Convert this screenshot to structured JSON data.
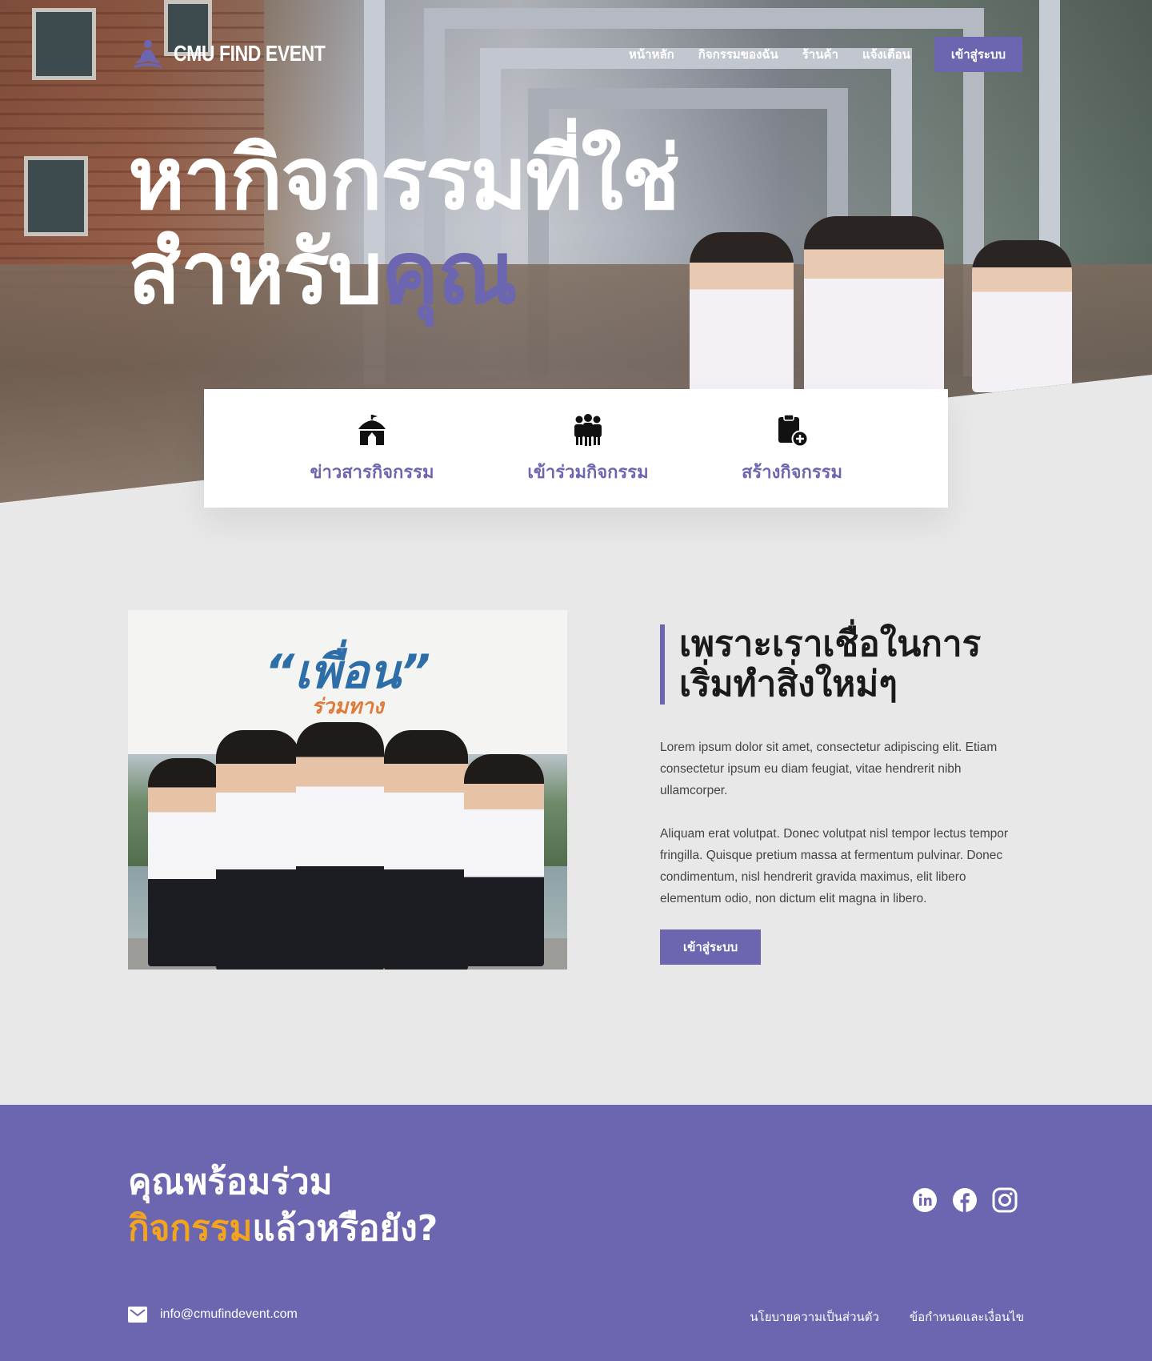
{
  "brand": {
    "name": "CMU FIND EVENT",
    "color": "#6c66b1",
    "accent_orange": "#f2a41f"
  },
  "nav": {
    "items": [
      {
        "label": "หน้าหลัก"
      },
      {
        "label": "กิจกรรมของฉัน"
      },
      {
        "label": "ร้านค้า"
      },
      {
        "label": "แจ้งเตือน"
      }
    ],
    "login_label": "เข้าสู่ระบบ"
  },
  "hero": {
    "line1": "หากิจกรรมที่ใช่",
    "line2_prefix": "สำหรับ",
    "line2_accent": "คุณ"
  },
  "features": [
    {
      "label": "ข่าวสารกิจกรรม",
      "icon": "circus-tent-icon"
    },
    {
      "label": "เข้าร่วมกิจกรรม",
      "icon": "people-group-icon"
    },
    {
      "label": "สร้างกิจกรรม",
      "icon": "clipboard-add-icon"
    }
  ],
  "about": {
    "image_title": "“เพื่อน”",
    "image_subtitle": "ร่วมทาง",
    "heading_line1": "เพราะเราเชื่อในการ",
    "heading_line2": "เริ่มทำสิ่งใหม่ๆ",
    "paragraph1": "Lorem ipsum dolor sit amet, consectetur adipiscing elit. Etiam consectetur ipsum eu diam feugiat, vitae hendrerit nibh ullamcorper.",
    "paragraph2": "Aliquam erat volutpat. Donec volutpat nisl tempor lectus tempor fringilla. Quisque pretium massa at fermentum pulvinar. Donec condimentum, nisl hendrerit gravida maximus, elit libero elementum odio, non dictum elit magna in libero.",
    "button_label": "เข้าสู่ระบบ"
  },
  "footer": {
    "cta_line1": "คุณพร้อมร่วม",
    "cta_highlight": "กิจกรรม",
    "cta_rest": "แล้วหรือยัง?",
    "social": [
      "linkedin-icon",
      "facebook-icon",
      "instagram-icon"
    ],
    "email": "info@cmufindevent.com",
    "privacy_label": "นโยบายความเป็นส่วนตัว",
    "terms_label": "ข้อกำหนดและเงื่อนไข"
  }
}
